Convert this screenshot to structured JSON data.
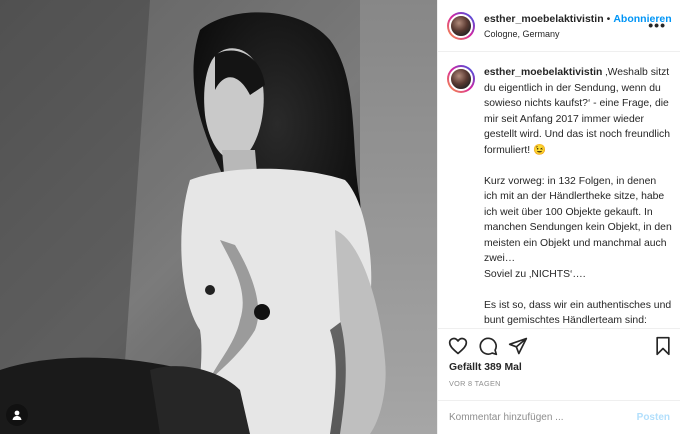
{
  "photo": {
    "alt_icon": "person-tag-icon"
  },
  "header": {
    "username": "esther_moebelaktivistin",
    "separator": "•",
    "follow_label": "Abonnieren",
    "location": "Cologne, Germany",
    "more_label": "•••"
  },
  "caption": {
    "username": "esther_moebelaktivistin",
    "text": " ‚Weshalb sitzt du eigentlich in der Sendung, wenn du sowieso nichts kaufst?‘ - eine Frage, die mir seit Anfang 2017 immer wieder gestellt wird. Und das ist noch freundlich formuliert! 😉\n\nKurz vorweg: in 132 Folgen, in denen ich mit an der Händlertheke sitze, habe ich weit über 100 Objekte gekauft. In manchen Sendungen kein Objekt, in den meisten ein Objekt und manchmal auch zwei…\nSoviel zu ‚NICHTS‘….\n\nEs ist so, dass wir ein authentisches und bunt gemischtes Händlerteam sind: Auktionatoren, Juweliere, Goldankäufer, Antik- und Trödelhändler, Vintagehändler u.v.m."
  },
  "actions": {
    "like_icon": "heart-icon",
    "comment_icon": "comment-icon",
    "share_icon": "share-icon",
    "save_icon": "bookmark-icon"
  },
  "likes_label": "Gefällt 389 Mal",
  "time_ago": "VOR 8 TAGEN",
  "comment": {
    "placeholder": "Kommentar hinzufügen ...",
    "post_label": "Posten"
  }
}
